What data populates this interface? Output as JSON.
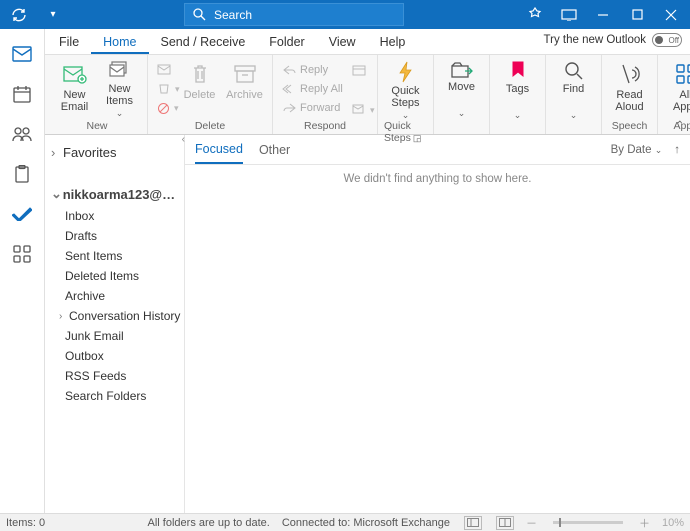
{
  "titlebar": {
    "search_placeholder": "Search"
  },
  "menubar": {
    "items": [
      "File",
      "Home",
      "Send / Receive",
      "Folder",
      "View",
      "Help"
    ],
    "active_index": 1,
    "try_label": "Try the new Outlook",
    "toggle_state": "Off"
  },
  "ribbon": {
    "new_group": {
      "label": "New",
      "new_email": "New\nEmail",
      "new_items": "New\nItems"
    },
    "delete_group": {
      "label": "Delete",
      "delete": "Delete",
      "archive": "Archive"
    },
    "respond_group": {
      "label": "Respond",
      "reply": "Reply",
      "reply_all": "Reply All",
      "forward": "Forward"
    },
    "quicksteps_group": {
      "label": "Quick Steps",
      "quick_steps": "Quick\nSteps"
    },
    "move_group": {
      "move": "Move"
    },
    "tags_group": {
      "tags": "Tags"
    },
    "find_group": {
      "find": "Find"
    },
    "speech_group": {
      "label": "Speech",
      "read_aloud": "Read\nAloud"
    },
    "apps_group": {
      "label": "Apps",
      "all_apps": "All\nApps"
    }
  },
  "folders": {
    "favorites_label": "Favorites",
    "account": "nikkoarma123@o...",
    "items": [
      "Inbox",
      "Drafts",
      "Sent Items",
      "Deleted Items",
      "Archive",
      "Conversation History",
      "Junk Email",
      "Outbox",
      "RSS Feeds",
      "Search Folders"
    ],
    "expandable_index": 5
  },
  "list": {
    "tabs": [
      "Focused",
      "Other"
    ],
    "active_tab": 0,
    "sort_label": "By Date",
    "empty_text": "We didn't find anything to show here."
  },
  "statusbar": {
    "items_label": "Items: 0",
    "sync_label": "All folders are up to date.",
    "conn_label": "Connected to: Microsoft Exchange",
    "zoom": "10%"
  }
}
